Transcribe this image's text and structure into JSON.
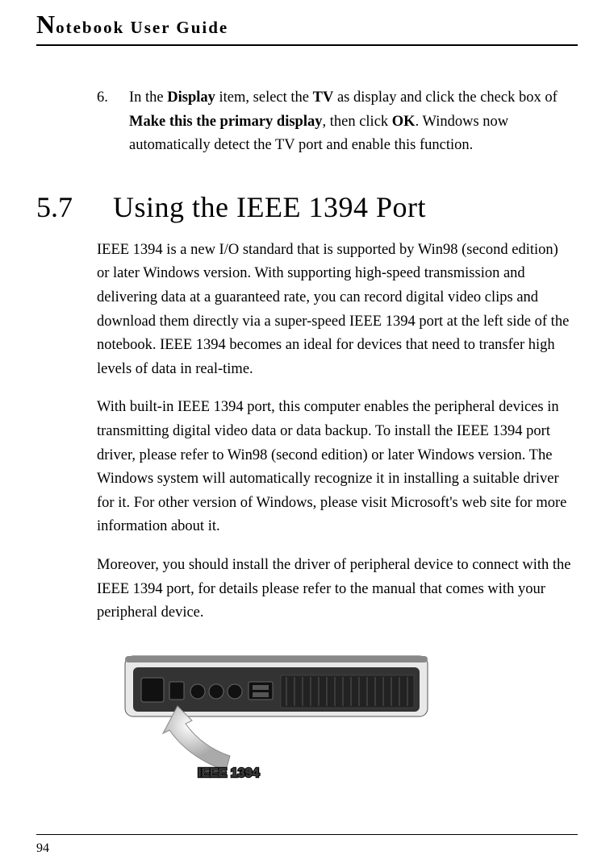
{
  "header": {
    "big": "N",
    "rest": "otebook User Guide"
  },
  "listItem": {
    "num": "6.",
    "t1": "In the ",
    "b1": "Display",
    "t2": " item, select the ",
    "b2": "TV",
    "t3": " as display and click the check box of ",
    "b3": "Make this the primary display",
    "t4": ", then click ",
    "b4": "OK",
    "t5": ". Windows now automatically detect the TV port and enable this function."
  },
  "section": {
    "num": "5.7",
    "title": "Using the IEEE 1394 Port"
  },
  "para1": "IEEE 1394 is a new I/O standard that is supported by Win98 (second edition) or later Windows version. With supporting high-speed transmission and delivering data at a guaranteed rate, you can record digital video clips and download them directly via a super-speed IEEE 1394 port at the left side of the notebook. IEEE 1394 becomes an ideal for devices that need to transfer high levels of data in real-time.",
  "para2": "With built-in IEEE 1394 port, this computer enables the peripheral devices in transmitting digital video data or data backup. To install the IEEE 1394 port driver, please refer to Win98 (second edition) or later Windows version. The Windows system will automatically recognize it in installing a suitable driver for it. For other version of Windows, please visit Microsoft's web site for more information about it.",
  "para3": "Moreover, you should install the driver of peripheral device to connect with the IEEE 1394 port, for details please refer to the manual that comes with your peripheral device.",
  "figureLabel": "IEEE 1394",
  "pageNum": "94"
}
